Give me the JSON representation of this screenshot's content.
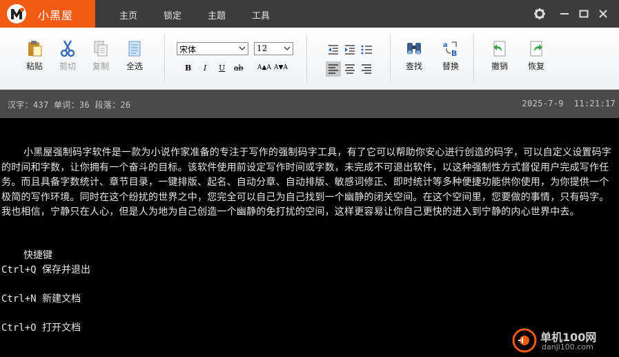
{
  "app": {
    "title": "小黑屋"
  },
  "menu": [
    {
      "label": "主页"
    },
    {
      "label": "锁定"
    },
    {
      "label": "主题"
    },
    {
      "label": "工具"
    }
  ],
  "toolbar": {
    "paste": "粘贴",
    "cut": "剪切",
    "copy": "复制",
    "select_all": "全选",
    "font_family": "宋体",
    "font_size": "12",
    "bold": "B",
    "italic": "I",
    "underline": "U",
    "strike": "ab",
    "grow": "A▲A",
    "shrink": "A▼A",
    "find": "查找",
    "replace": "替换",
    "undo": "撤销",
    "redo": "恢复"
  },
  "status": {
    "counts": "汉字：437 单词：36 段落：26",
    "datetime": "2025-7-9  11:21:17"
  },
  "document": {
    "paragraph": "小黑屋强制码字软件是一款为小说作家准备的专注于写作的强制码字工具，有了它可以帮助你安心进行创造的码字，可以自定义设置码字的时间和字数，让你拥有一个奋斗的目标。该软件使用前设定写作时间或字数，未完成不可退出软件，以这种强制性方式督促用户完成写作任务。而且具备字数统计、章节目录，一键排版、起名、自动分章、自动排版、敏感词修正、即时统计等多种便捷功能供你使用，为你提供一个极简的写作环境。同时在这个纷扰的世界之中，您完全可以自己为自己找到一个幽静的闭关空间。在这个空间里，您要做的事情，只有码字。我也相信，宁静只在人心，但是人为地为自己创造一个幽静的免打扰的空间，这样更容易让你自己更快的进入到宁静的内心世界中去。",
    "shortcut_heading": "快捷键",
    "shortcuts": [
      "Ctrl+Q 保存并退出",
      "Ctrl+N 新建文档",
      "Ctrl+O 打开文档"
    ]
  },
  "watermark": {
    "line1": "单机100网",
    "line2": "danji100.com"
  },
  "colors": {
    "brand": "#f35a14",
    "titlebar": "#3c3c3c",
    "statusbar": "#4a4a4a",
    "editor_bg": "#000000"
  }
}
